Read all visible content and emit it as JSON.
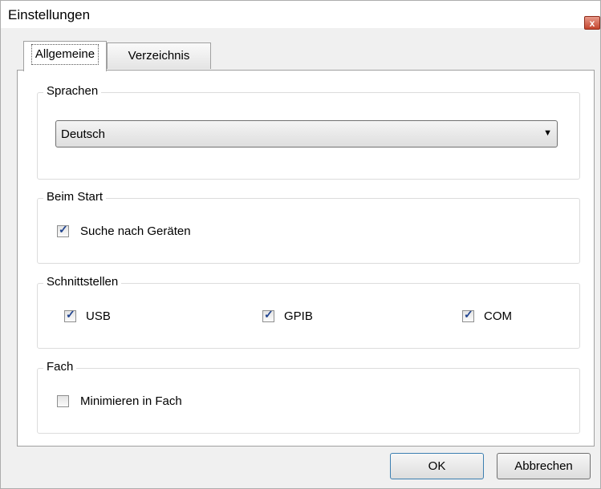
{
  "window": {
    "title": "Einstellungen",
    "close_glyph": "x"
  },
  "tabs": [
    {
      "label": "Allgemeine",
      "active": true
    },
    {
      "label": "Verzeichnis",
      "active": false
    }
  ],
  "groups": {
    "sprachen": {
      "legend": "Sprachen",
      "selected": "Deutsch"
    },
    "beim_start": {
      "legend": "Beim Start",
      "option": {
        "label": "Suche nach Geräten",
        "checked": true
      }
    },
    "schnittstellen": {
      "legend": "Schnittstellen",
      "options": [
        {
          "label": "USB",
          "checked": true
        },
        {
          "label": "GPIB",
          "checked": true
        },
        {
          "label": "COM",
          "checked": true
        }
      ]
    },
    "fach": {
      "legend": "Fach",
      "option": {
        "label": "Minimieren in Fach",
        "checked": false
      }
    }
  },
  "buttons": {
    "ok": "OK",
    "cancel": "Abbrechen"
  },
  "checkmark_glyph": "✓"
}
